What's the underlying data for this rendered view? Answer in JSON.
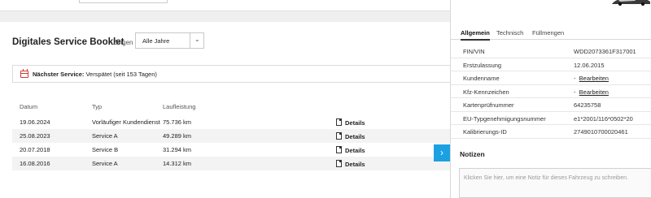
{
  "booklet": {
    "title": "Digitales Service Booklet",
    "show_label": "Zeigen",
    "filter_value": "Alle Jahre"
  },
  "notice": {
    "label": "Nächster Service:",
    "text": "Verspätet (seit 153 Tagen)"
  },
  "table": {
    "headers": [
      "Datum",
      "Typ",
      "Laufleistung"
    ],
    "rows": [
      {
        "date": "19.06.2024",
        "type": "Vorläufiger Kundendienst",
        "mileage": "75.736 km",
        "action": "Details"
      },
      {
        "date": "25.08.2023",
        "type": "Service A",
        "mileage": "49.289 km",
        "action": "Details"
      },
      {
        "date": "20.07.2018",
        "type": "Service B",
        "mileage": "31.294 km",
        "action": "Details"
      },
      {
        "date": "16.08.2016",
        "type": "Service A",
        "mileage": "14.312 km",
        "action": "Details"
      }
    ]
  },
  "panel": {
    "tabs": [
      "Allgemein",
      "Technisch",
      "Füllmengen"
    ],
    "info": [
      {
        "key": "FIN/VIN",
        "value": "WDD2073361F317001"
      },
      {
        "key": "Erstzulassung",
        "value": "12.06.2015"
      },
      {
        "key": "Kundenname",
        "value": "-",
        "link": "Bearbeiten"
      },
      {
        "key": "Kfz-Kennzeichen",
        "value": "-",
        "link": "Bearbeiten"
      },
      {
        "key": "Kartenprüfnummer",
        "value": "64235758"
      },
      {
        "key": "EU-Typgenehmigungsnummer",
        "value": "e1*2001/116*0502*20"
      },
      {
        "key": "Kalibrierungs-ID",
        "value": "2749010700020461"
      }
    ],
    "notes_title": "Notizen",
    "notes_placeholder": "Klicken Sie hier, um eine Notiz für dieses Fahrzeug zu schreiben."
  },
  "icons": {
    "toggle": "chevron-right-icon",
    "calendar": "calendar-icon",
    "document": "document-icon"
  },
  "colors": {
    "accent": "#1ba1e2",
    "alert": "#d23a3a"
  }
}
